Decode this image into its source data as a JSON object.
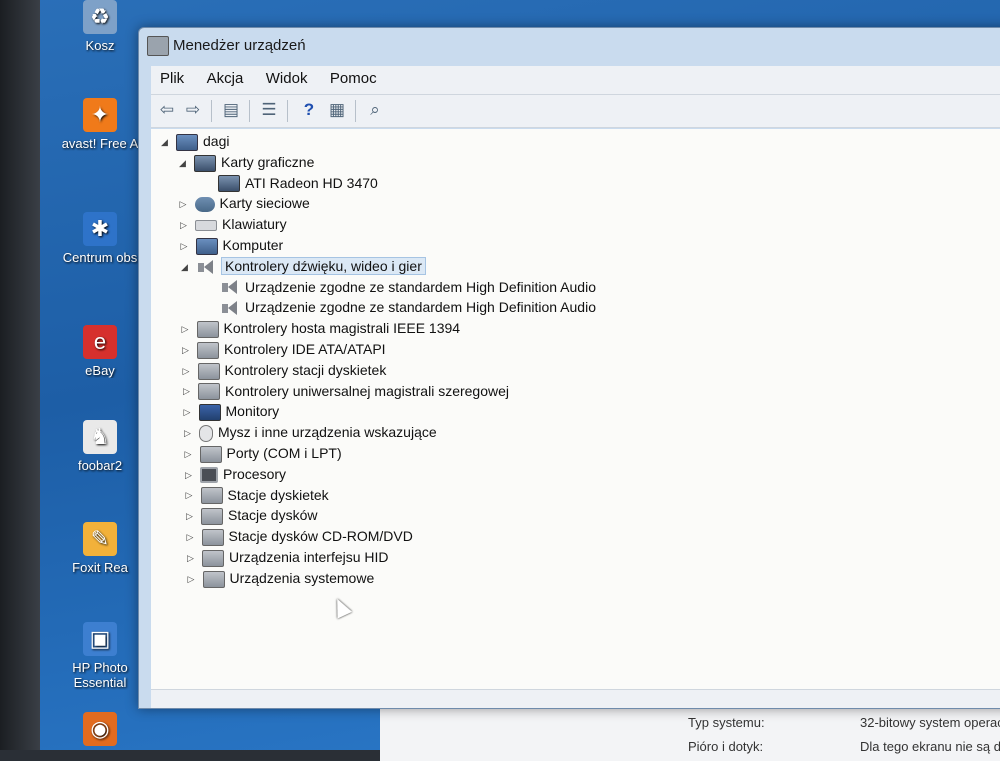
{
  "desktop": {
    "icons": [
      {
        "label": "Kosz",
        "glyph": "♻",
        "color": "#7ea1c8"
      },
      {
        "label": "avast! Free A",
        "glyph": "✦",
        "color": "#f07a1a"
      },
      {
        "label": "Centrum obs",
        "glyph": "✱",
        "color": "#2e73c9"
      },
      {
        "label": "eBay",
        "glyph": "e",
        "color": "#d6302d"
      },
      {
        "label": "foobar2",
        "glyph": "♞",
        "color": "#e9e9e9"
      },
      {
        "label": "Foxit Rea",
        "glyph": "✎",
        "color": "#f2b13a"
      },
      {
        "label": "HP Photo",
        "label2": "Essential",
        "glyph": "▣",
        "color": "#3d7fd0"
      },
      {
        "label": "",
        "glyph": "◉",
        "color": "#e26b1f"
      }
    ]
  },
  "window": {
    "title": "Menedżer urządzeń",
    "menu": [
      "Plik",
      "Akcja",
      "Widok",
      "Pomoc"
    ],
    "toolbar": [
      "back-arrow-icon",
      "forward-arrow-icon",
      "properties-icon",
      "list-icon",
      "help-icon",
      "view-icon",
      "scan-hardware-icon"
    ],
    "tree": {
      "root": "dagi",
      "categories": [
        {
          "label": "Karty graficzne",
          "expanded": true,
          "icon": "display-adapter-icon",
          "children": [
            "ATI Radeon HD 3470"
          ]
        },
        {
          "label": "Karty sieciowe",
          "expanded": false,
          "icon": "network-adapter-icon"
        },
        {
          "label": "Klawiatury",
          "expanded": false,
          "icon": "keyboard-icon"
        },
        {
          "label": "Komputer",
          "expanded": false,
          "icon": "computer-icon"
        },
        {
          "label": "Kontrolery dźwięku, wideo i gier",
          "expanded": true,
          "selected": true,
          "icon": "sound-icon",
          "children": [
            "Urządzenie zgodne ze standardem High Definition Audio",
            "Urządzenie zgodne ze standardem High Definition Audio"
          ]
        },
        {
          "label": "Kontrolery hosta magistrali IEEE 1394",
          "expanded": false,
          "icon": "ieee1394-icon"
        },
        {
          "label": "Kontrolery IDE ATA/ATAPI",
          "expanded": false,
          "icon": "ide-controller-icon"
        },
        {
          "label": "Kontrolery stacji dyskietek",
          "expanded": false,
          "icon": "floppy-controller-icon"
        },
        {
          "label": "Kontrolery uniwersalnej magistrali szeregowej",
          "expanded": false,
          "icon": "usb-icon"
        },
        {
          "label": "Monitory",
          "expanded": false,
          "icon": "monitor-icon"
        },
        {
          "label": "Mysz i inne urządzenia wskazujące",
          "expanded": false,
          "icon": "mouse-icon"
        },
        {
          "label": "Porty (COM i LPT)",
          "expanded": false,
          "icon": "port-icon"
        },
        {
          "label": "Procesory",
          "expanded": false,
          "icon": "processor-icon"
        },
        {
          "label": "Stacje dyskietek",
          "expanded": false,
          "icon": "floppy-drive-icon"
        },
        {
          "label": "Stacje dysków",
          "expanded": false,
          "icon": "disk-drive-icon"
        },
        {
          "label": "Stacje dysków CD-ROM/DVD",
          "expanded": false,
          "icon": "cdrom-icon"
        },
        {
          "label": "Urządzenia interfejsu HID",
          "expanded": false,
          "icon": "hid-icon"
        },
        {
          "label": "Urządzenia systemowe",
          "expanded": false,
          "icon": "system-devices-icon"
        }
      ]
    }
  },
  "background_window": {
    "rows": [
      {
        "label": "Typ systemu:",
        "value": "32-bitowy system operac"
      },
      {
        "label": "Pióro i dotyk:",
        "value": "Dla tego ekranu nie są d"
      }
    ]
  }
}
